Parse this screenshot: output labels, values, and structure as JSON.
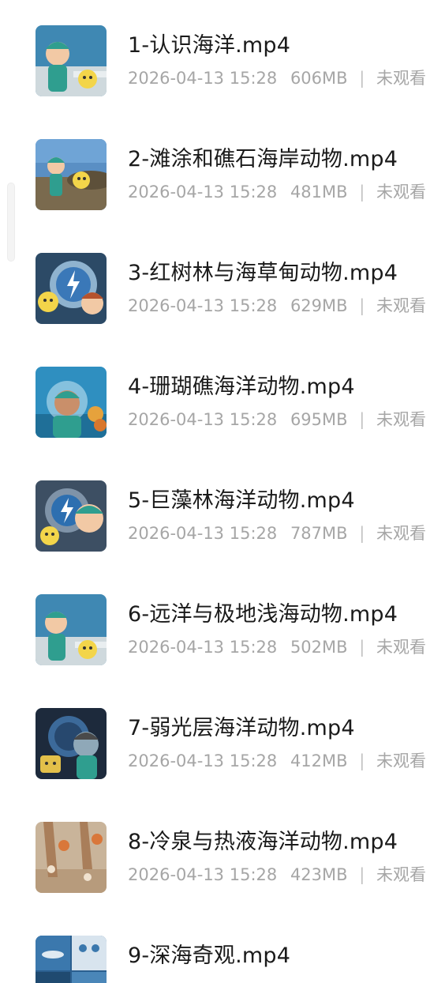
{
  "files": [
    {
      "name": "1-认识海洋.mp4",
      "date": "2026-04-13 15:28",
      "size": "606MB",
      "status": "未观看"
    },
    {
      "name": "2-滩涂和礁石海岸动物.mp4",
      "date": "2026-04-13 15:28",
      "size": "481MB",
      "status": "未观看"
    },
    {
      "name": "3-红树林与海草甸动物.mp4",
      "date": "2026-04-13 15:28",
      "size": "629MB",
      "status": "未观看"
    },
    {
      "name": "4-珊瑚礁海洋动物.mp4",
      "date": "2026-04-13 15:28",
      "size": "695MB",
      "status": "未观看"
    },
    {
      "name": "5-巨藻林海洋动物.mp4",
      "date": "2026-04-13 15:28",
      "size": "787MB",
      "status": "未观看"
    },
    {
      "name": "6-远洋与极地浅海动物.mp4",
      "date": "2026-04-13 15:28",
      "size": "502MB",
      "status": "未观看"
    },
    {
      "name": "7-弱光层海洋动物.mp4",
      "date": "2026-04-13 15:28",
      "size": "412MB",
      "status": "未观看"
    },
    {
      "name": "8-冷泉与热液海洋动物.mp4",
      "date": "2026-04-13 15:28",
      "size": "423MB",
      "status": "未观看"
    },
    {
      "name": "9-深海奇观.mp4",
      "date": "",
      "size": "",
      "status": ""
    }
  ],
  "meta_separator": "|",
  "colors": {
    "title_text": "#1a1a1a",
    "meta_text": "#a6a6a6"
  }
}
